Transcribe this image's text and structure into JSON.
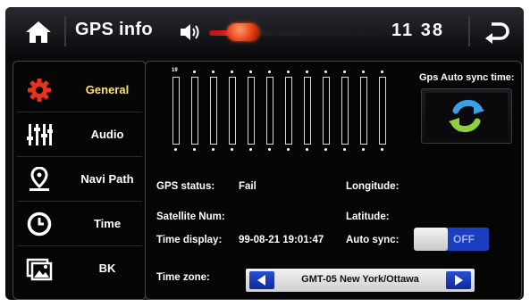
{
  "header": {
    "title": "GPS info",
    "volume_level": 0.2,
    "clock": "11 38"
  },
  "sidebar": {
    "items": [
      {
        "label": "General",
        "icon": "gear-icon",
        "active": true
      },
      {
        "label": "Audio",
        "icon": "equalizer-icon",
        "active": false
      },
      {
        "label": "Navi Path",
        "icon": "map-pin-icon",
        "active": false
      },
      {
        "label": "Time",
        "icon": "clock-icon",
        "active": false
      },
      {
        "label": "BK",
        "icon": "background-image-icon",
        "active": false
      }
    ]
  },
  "satellites": {
    "first_label": "19",
    "count": 12,
    "signal_levels": [
      0,
      0,
      0,
      0,
      0,
      0,
      0,
      0,
      0,
      0,
      0,
      0
    ]
  },
  "info": {
    "gps_status_label": "GPS status:",
    "gps_status_value": "Fail",
    "satellite_num_label": "Satellite Num:",
    "time_display_label": "Time display:",
    "time_display_value": "99-08-21 19:01:47",
    "longitude_label": "Longitude:",
    "latitude_label": "Latitude:",
    "auto_sync_label": "Auto sync:",
    "auto_sync_state": "OFF",
    "time_zone_label": "Time zone:",
    "time_zone_value": "GMT-05 New York/Ottawa"
  },
  "sync": {
    "title": "Gps Auto sync time:"
  },
  "colors": {
    "accent_active": "#ffe36a",
    "slider_fill": "#ff2a2a",
    "toggle_bg": "#1b3dbf",
    "sync_blue": "#3aa0e8",
    "sync_green": "#8cd33a"
  }
}
